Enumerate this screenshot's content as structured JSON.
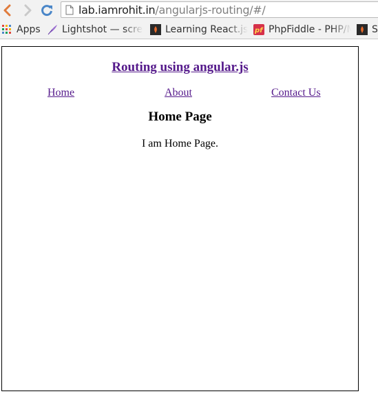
{
  "browser": {
    "url_host": "lab.iamrohit.in",
    "url_path": "/angularjs-routing/#/"
  },
  "bookmarks": {
    "apps_label": "Apps",
    "items": [
      {
        "label": "Lightshot — scre"
      },
      {
        "label": "Learning React.js"
      },
      {
        "label": "PhpFiddle - PHP/M"
      },
      {
        "label": "S"
      }
    ]
  },
  "page": {
    "site_title": "Routing using angular.js",
    "nav": {
      "home": "Home",
      "about": "About",
      "contact": "Contact Us"
    },
    "heading": "Home Page",
    "body_text": "I am Home Page."
  },
  "colors": {
    "link_visited": "#551a8b",
    "toolbar_bg": "#f2f2f2",
    "reload_blue": "#4a86c8",
    "back_orange": "#e07b3c"
  }
}
